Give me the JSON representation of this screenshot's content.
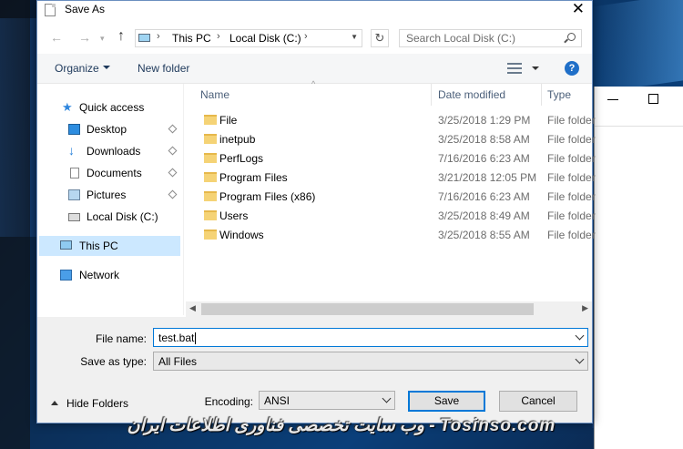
{
  "window": {
    "title": "Save As"
  },
  "nav": {
    "address": [
      "This PC",
      "Local Disk (C:)"
    ],
    "search_placeholder": "Search Local Disk (C:)"
  },
  "toolbar": {
    "organize": "Organize",
    "new_folder": "New folder",
    "help": "?"
  },
  "sidebar": {
    "items": [
      {
        "label": "Quick access",
        "icon": "star-icon"
      },
      {
        "label": "Desktop",
        "icon": "desktop-icon",
        "pinned": true
      },
      {
        "label": "Downloads",
        "icon": "download-icon",
        "pinned": true
      },
      {
        "label": "Documents",
        "icon": "document-icon",
        "pinned": true
      },
      {
        "label": "Pictures",
        "icon": "pictures-icon",
        "pinned": true
      },
      {
        "label": "Local Disk (C:)",
        "icon": "disk-icon"
      },
      {
        "label": "This PC",
        "icon": "pc-icon",
        "selected": true
      },
      {
        "label": "Network",
        "icon": "network-icon"
      }
    ]
  },
  "filelist": {
    "columns": {
      "name": "Name",
      "date": "Date modified",
      "type": "Type"
    },
    "rows": [
      {
        "name": "File",
        "date": "3/25/2018 1:29 PM",
        "type": "File folder"
      },
      {
        "name": "inetpub",
        "date": "3/25/2018 8:58 AM",
        "type": "File folder"
      },
      {
        "name": "PerfLogs",
        "date": "7/16/2016 6:23 AM",
        "type": "File folder"
      },
      {
        "name": "Program Files",
        "date": "3/21/2018 12:05 PM",
        "type": "File folder"
      },
      {
        "name": "Program Files (x86)",
        "date": "7/16/2016 6:23 AM",
        "type": "File folder"
      },
      {
        "name": "Users",
        "date": "3/25/2018 8:49 AM",
        "type": "File folder"
      },
      {
        "name": "Windows",
        "date": "3/25/2018 8:55 AM",
        "type": "File folder"
      }
    ]
  },
  "form": {
    "file_name_label": "File name:",
    "file_name_value": "test.bat",
    "save_type_label": "Save as type:",
    "save_type_value": "All Files",
    "encoding_label": "Encoding:",
    "encoding_value": "ANSI",
    "hide_folders": "Hide Folders",
    "save": "Save",
    "cancel": "Cancel"
  },
  "watermark": "وب سایت تخصصی فناوری اطلاعات ایران - Tosinso.com"
}
